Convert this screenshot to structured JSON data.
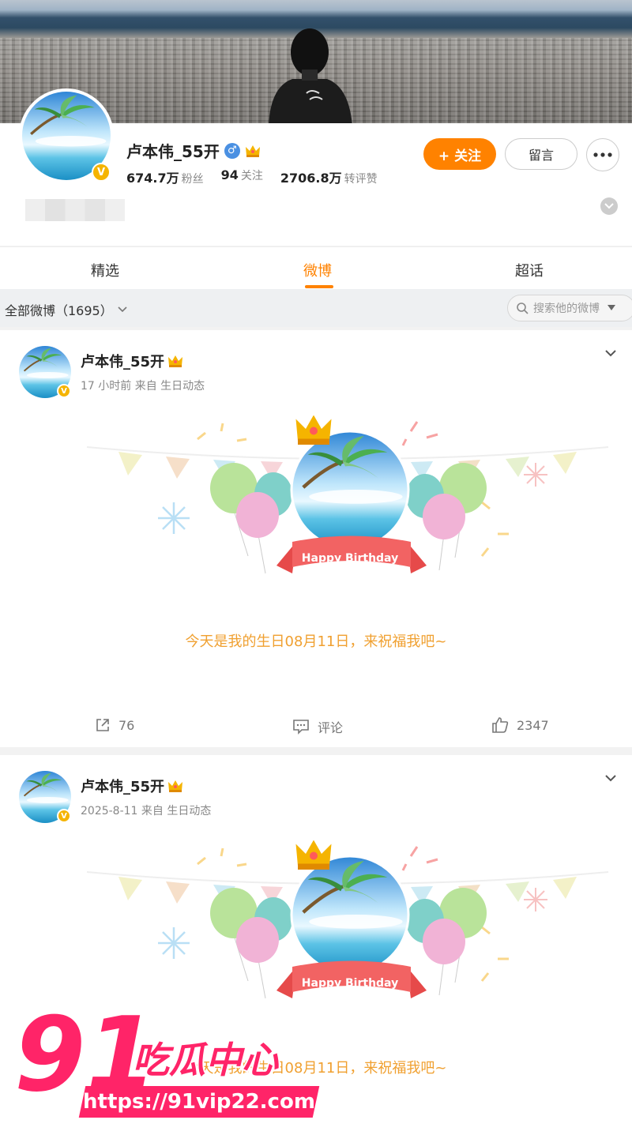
{
  "profile": {
    "name": "卢本伟_55开",
    "followers_value": "674.7万",
    "followers_label": "粉丝",
    "following_value": "94",
    "following_label": "关注",
    "reposts_value": "2706.8万",
    "reposts_label": "转评赞",
    "follow_button": "+ 关注",
    "message_button": "留言",
    "verified_mark": "V",
    "gender_mark": "♂"
  },
  "tabs": [
    {
      "label": "精选"
    },
    {
      "label": "微博"
    },
    {
      "label": "超话"
    }
  ],
  "filter": {
    "label": "全部微博（1695）",
    "search_placeholder": "搜索他的微博"
  },
  "posts": [
    {
      "author": "卢本伟_55开",
      "meta": "17 小时前  来自  生日动态",
      "banner_text": "Happy Birthday",
      "text": "今天是我的生日08月11日，来祝福我吧~",
      "reposts": "76",
      "comments": "评论",
      "likes": "2347"
    },
    {
      "author": "卢本伟_55开",
      "meta": "2025-8-11  来自  生日动态",
      "banner_text": "Happy Birthday",
      "text": "今天是我的生日08月11日，来祝福我吧~"
    }
  ],
  "watermark": {
    "number": "91",
    "title": "吃瓜中心",
    "url": "https://91vip22.com"
  },
  "colors": {
    "accent": "#ff8200",
    "verified": "#f5b400",
    "watermark": "#ff2468"
  }
}
